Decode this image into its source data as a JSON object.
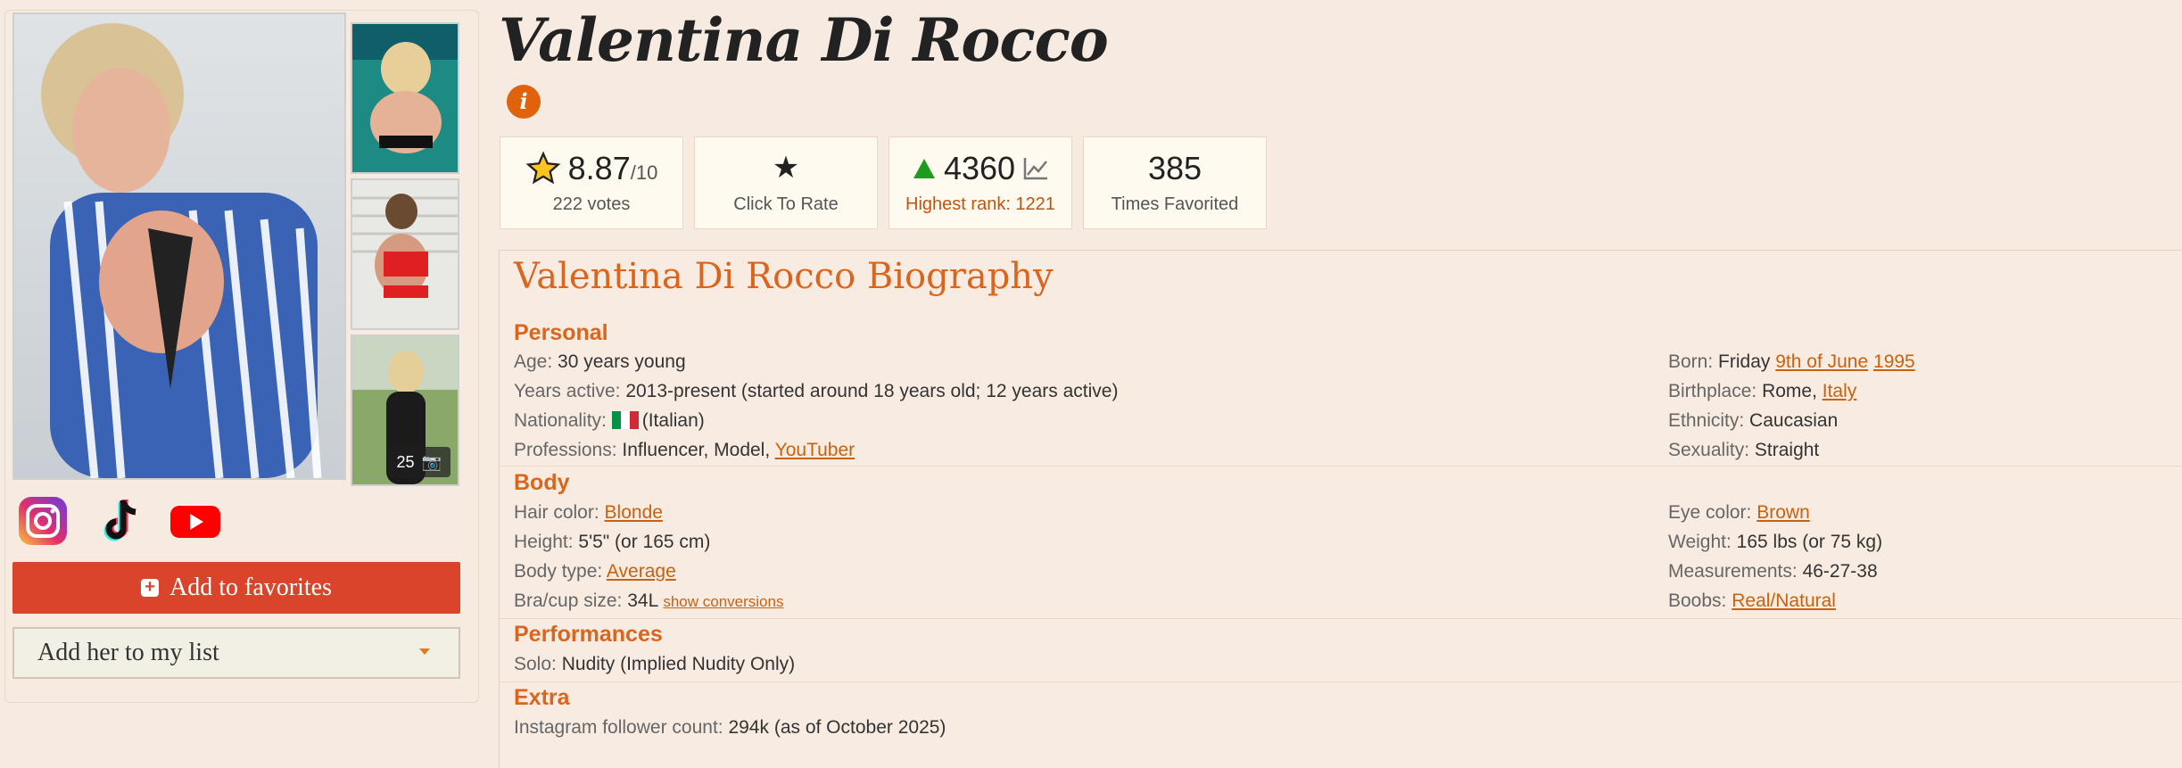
{
  "profile": {
    "name": "Valentina Di Rocco",
    "photo_count": "25"
  },
  "buttons": {
    "add_favorites": "Add to favorites",
    "add_list": "Add her to my list"
  },
  "social": [
    "instagram-icon",
    "tiktok-icon",
    "youtube-icon"
  ],
  "stats": {
    "rating": "8.87",
    "rating_suffix": "/10",
    "votes": "222 votes",
    "click_rate": "Click To Rate",
    "rank": "4360",
    "highest_rank": "Highest rank: 1221",
    "favorited_count": "385",
    "favorited_label": "Times Favorited"
  },
  "bio": {
    "title": "Valentina Di Rocco Biography",
    "personal": {
      "heading": "Personal",
      "age_label": "Age:",
      "age": "30 years young",
      "years_active_label": "Years active:",
      "years_active": "2013-present (started around 18 years old; 12 years active)",
      "nationality_label": "Nationality:",
      "nationality": "(Italian)",
      "professions_label": "Professions:",
      "professions": "Influencer, Model,",
      "professions_link": "YouTuber",
      "born_label": "Born:",
      "born_day": "Friday",
      "born_date": "9th of June",
      "born_year": "1995",
      "birthplace_label": "Birthplace:",
      "birthplace_city": "Rome,",
      "birthplace_country": "Italy",
      "ethnicity_label": "Ethnicity:",
      "ethnicity": "Caucasian",
      "sexuality_label": "Sexuality:",
      "sexuality": "Straight"
    },
    "body": {
      "heading": "Body",
      "hair_label": "Hair color:",
      "hair": "Blonde",
      "height_label": "Height:",
      "height": "5'5\" (or 165 cm)",
      "bodytype_label": "Body type:",
      "bodytype": "Average",
      "bra_label": "Bra/cup size:",
      "bra": "34L",
      "bra_link": "show conversions",
      "eye_label": "Eye color:",
      "eye": "Brown",
      "weight_label": "Weight:",
      "weight": "165 lbs (or 75 kg)",
      "measure_label": "Measurements:",
      "measure": "46-27-38",
      "boobs_label": "Boobs:",
      "boobs": "Real/Natural"
    },
    "performances": {
      "heading": "Performances",
      "solo_label": "Solo:",
      "solo": "Nudity (Implied Nudity Only)"
    },
    "extra": {
      "heading": "Extra",
      "instagram_label": "Instagram follower count:",
      "instagram": "294k (as of October 2025)"
    }
  },
  "colors": {
    "background": "#f7ebe1",
    "accent": "#d9661e",
    "button": "#d8452b",
    "link": "#c8620f",
    "rank_up": "#1e9c1e"
  }
}
